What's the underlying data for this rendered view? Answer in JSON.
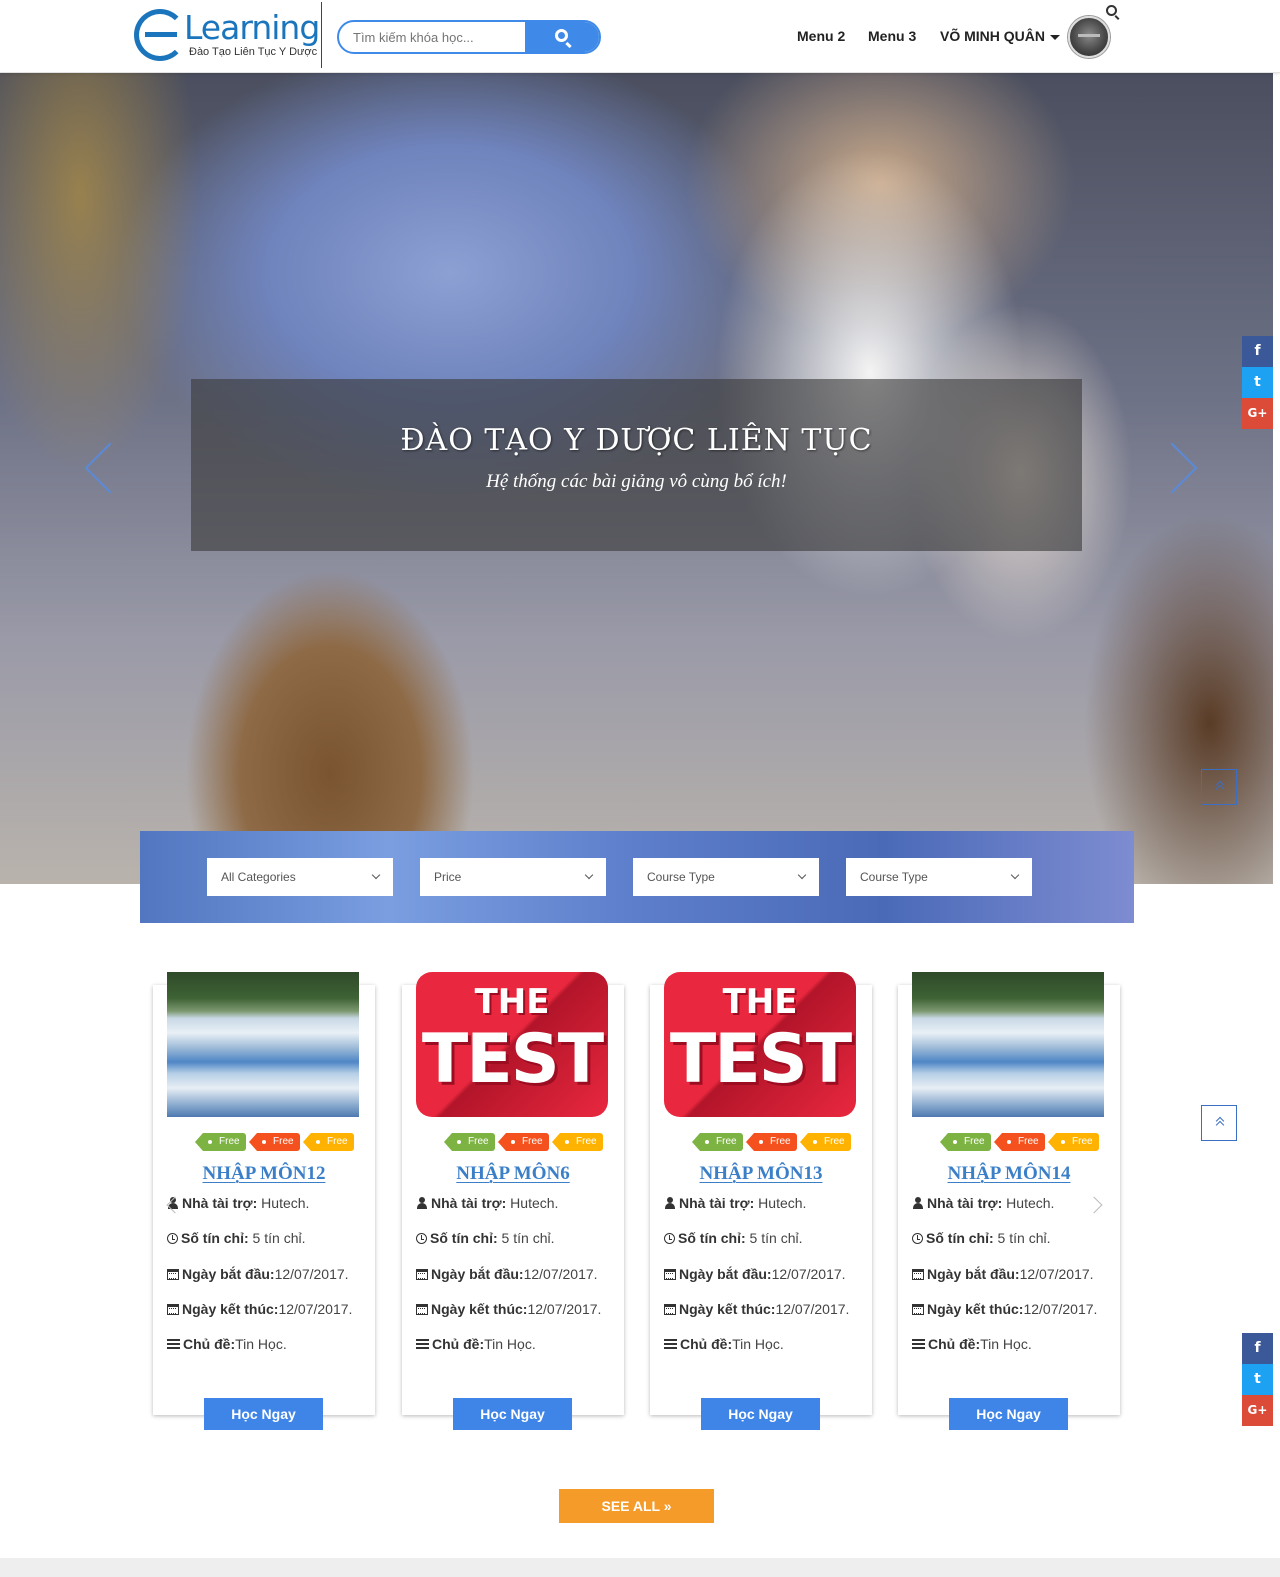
{
  "header": {
    "logo": {
      "word": "Learning",
      "subtitle": "Đào Tạo Liên Tục Y Dược"
    },
    "search": {
      "placeholder": "Tìm kiếm khóa học...",
      "value": ""
    },
    "nav": [
      {
        "label": "Menu 2"
      },
      {
        "label": "Menu 3"
      },
      {
        "label": "VÕ MINH QUÂN"
      }
    ]
  },
  "hero": {
    "title": "ĐÀO TẠO Y DƯỢC LIÊN TỤC",
    "subtitle": "Hệ thống các bài giảng vô cùng bổ ích!"
  },
  "filters": [
    {
      "label": "All Categories"
    },
    {
      "label": "Price"
    },
    {
      "label": "Course Type"
    },
    {
      "label": "Course Type"
    }
  ],
  "course_labels": {
    "sponsor": "Nhà tài trợ:",
    "credits": "Số tín chỉ:",
    "start": "Ngày bắt đầu:",
    "end": "Ngày kết thúc:",
    "topic": "Chủ đề:",
    "button": "Học Ngay"
  },
  "courses": [
    {
      "title": "NHẬP MÔN12",
      "thumbnail": "lake",
      "tags": [
        "Free",
        "Free",
        "Free"
      ],
      "sponsor": " Hutech.",
      "credits": " 5 tín chỉ.",
      "start": "12/07/2017.",
      "end": "12/07/2017.",
      "topic": "Tin Học."
    },
    {
      "title": "NHẬP MÔN6",
      "thumbnail": "the-test",
      "tags": [
        "Free",
        "Free",
        "Free"
      ],
      "sponsor": " Hutech.",
      "credits": " 5 tín chỉ.",
      "start": "12/07/2017.",
      "end": "12/07/2017.",
      "topic": "Tin Học."
    },
    {
      "title": "NHẬP MÔN13",
      "thumbnail": "the-test",
      "tags": [
        "Free",
        "Free",
        "Free"
      ],
      "sponsor": " Hutech.",
      "credits": " 5 tín chỉ.",
      "start": "12/07/2017.",
      "end": "12/07/2017.",
      "topic": "Tin Học."
    },
    {
      "title": "NHẬP MÔN14",
      "thumbnail": "lake",
      "tags": [
        "Free",
        "Free",
        "Free"
      ],
      "sponsor": " Hutech.",
      "credits": " 5 tín chỉ.",
      "start": "12/07/2017.",
      "end": "12/07/2017.",
      "topic": "Tin Học."
    }
  ],
  "thumb_text": {
    "line1": "THE",
    "line2": "TEST"
  },
  "see_all": "SEE ALL »",
  "social": {
    "facebook": "f",
    "twitter": "t",
    "googleplus": "G+"
  },
  "colors": {
    "primary": "#3f85e8",
    "accent_orange": "#f59b2a",
    "tag_green": "#7cb342",
    "tag_red": "#f4511e",
    "tag_amber": "#ffb300",
    "title_blue": "#3b7fc8"
  }
}
